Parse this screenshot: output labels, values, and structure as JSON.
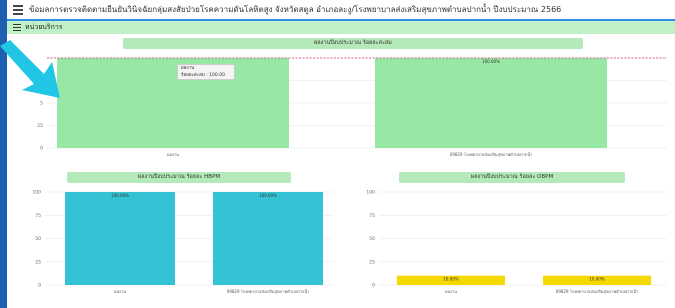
{
  "window": {
    "title": "ข้อมลการตรวจติดตามยืนยันวินิจฉัยกลุ่มสงสัยป่วยโรคความดันโลหิตสูง จังหวัดสตูล อำเภอละงู/โรงพยาบาลส่งเสริมสุขภาพตำบลปากน้ำ ปีงบประมาณ 2566",
    "section_label": "หน่วยบริการ"
  },
  "icons": {
    "menu": "menu-icon",
    "section_menu": "menu-icon",
    "pointer": "arrow-pointer-icon"
  },
  "colors": {
    "green_bar": "#97e8a5",
    "cyan_bar": "#33c3d4",
    "yellow_bar": "#f5d800",
    "target_line": "#e0306a",
    "frame_border": "#1f5fb0"
  },
  "tooltip": {
    "line1": "ผลงาน",
    "line2": "ร้อยละสะสม : 100.00"
  },
  "chart_data": [
    {
      "type": "bar",
      "title": "ผลงานปีงบประมาณ ร้อยละสะสม",
      "categories": [
        "ผลงาน",
        "09829 โรงพยาบาลส่งเสริมสุขภาพตำบลปากน้ำ"
      ],
      "values": [
        100.0,
        100.0
      ],
      "data_labels": [
        "",
        "100.00%"
      ],
      "yticks": [
        "",
        "7",
        "5",
        "25",
        "0"
      ],
      "ylim": [
        0,
        100
      ],
      "target_line": 100
    },
    {
      "type": "bar",
      "title": "ผลงานปีงบประมาณ ร้อยละ HBPM",
      "categories": [
        "ผลงาน",
        "09829 โรงพยาบาลส่งเสริมสุขภาพตำบลปากน้ำ"
      ],
      "values": [
        100.0,
        100.0
      ],
      "data_labels": [
        "100.00%",
        "100.00%"
      ],
      "yticks": [
        "100",
        "75",
        "50",
        "25",
        "0"
      ],
      "ylim": [
        0,
        100
      ]
    },
    {
      "type": "bar",
      "title": "ผลงานปีงบประมาณ ร้อยละ OBPM",
      "categories": [
        "ผลงาน",
        "09829 โรงพยาบาลส่งเสริมสุขภาพตำบลปากน้ำ"
      ],
      "values": [
        10.0,
        10.0
      ],
      "data_labels": [
        "10.00%",
        "10.00%"
      ],
      "yticks": [
        "100",
        "75",
        "50",
        "25",
        "0"
      ],
      "ylim": [
        0,
        100
      ]
    }
  ]
}
